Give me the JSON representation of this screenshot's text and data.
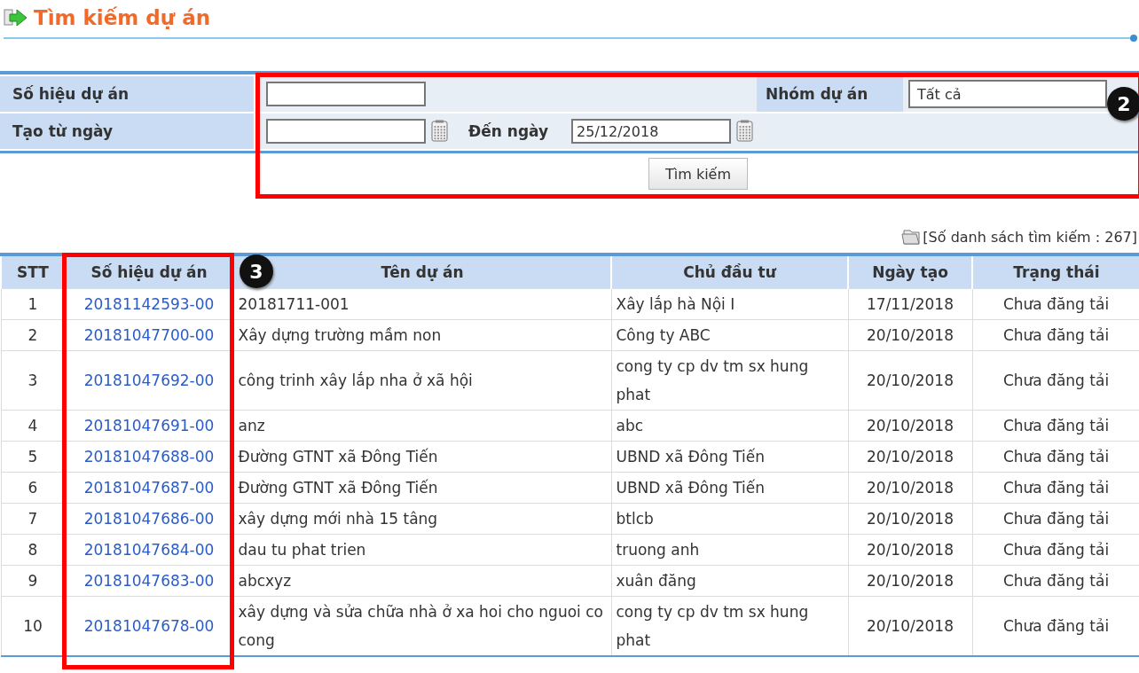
{
  "page_title": "Tìm kiếm dự án",
  "search_form": {
    "project_code": {
      "label": "Số hiệu dự án"
    },
    "project_group": {
      "label": "Nhóm dự án",
      "value": "Tất cả"
    },
    "date_from": {
      "label": "Tạo từ ngày"
    },
    "date_to": {
      "label": "Đến ngày",
      "value": "25/12/2018"
    },
    "search_button": "Tìm kiếm"
  },
  "result_count": "[Số danh sách tìm kiếm : 267]",
  "table": {
    "columns": [
      "STT",
      "Số hiệu dự án",
      "Tên dự án",
      "Chủ đầu tư",
      "Ngày tạo",
      "Trạng thái"
    ],
    "rows": [
      [
        "1",
        "20181142593-00",
        "20181711-001",
        "Xây lắp hà Nội I",
        "17/11/2018",
        "Chưa đăng tải"
      ],
      [
        "2",
        "20181047700-00",
        "Xây dựng trường mầm non",
        "Công ty ABC",
        "20/10/2018",
        "Chưa đăng tải"
      ],
      [
        "3",
        "20181047692-00",
        "công trinh xây lắp nha ở xã hội",
        "cong ty cp dv tm sx hung phat",
        "20/10/2018",
        "Chưa đăng tải"
      ],
      [
        "4",
        "20181047691-00",
        "anz",
        "abc",
        "20/10/2018",
        "Chưa đăng tải"
      ],
      [
        "5",
        "20181047688-00",
        "Đường GTNT xã Đông Tiến",
        "UBND xã Đông Tiến",
        "20/10/2018",
        "Chưa đăng tải"
      ],
      [
        "6",
        "20181047687-00",
        "Đường GTNT xã Đông Tiến",
        "UBND xã Đông Tiến",
        "20/10/2018",
        "Chưa đăng tải"
      ],
      [
        "7",
        "20181047686-00",
        "xây dựng mới nhà 15 tâng",
        "btlcb",
        "20/10/2018",
        "Chưa đăng tải"
      ],
      [
        "8",
        "20181047684-00",
        "dau tu phat trien",
        "truong anh",
        "20/10/2018",
        "Chưa đăng tải"
      ],
      [
        "9",
        "20181047683-00",
        "abcxyz",
        "xuân đăng",
        "20/10/2018",
        "Chưa đăng tải"
      ],
      [
        "10",
        "20181047678-00",
        "xây dựng và sửa chữa nhà ở xa hoi cho nguoi co cong",
        "cong ty cp dv tm sx hung phat",
        "20/10/2018",
        "Chưa đăng tải"
      ]
    ]
  },
  "annotations": [
    {
      "label": "2"
    },
    {
      "label": "3"
    }
  ]
}
